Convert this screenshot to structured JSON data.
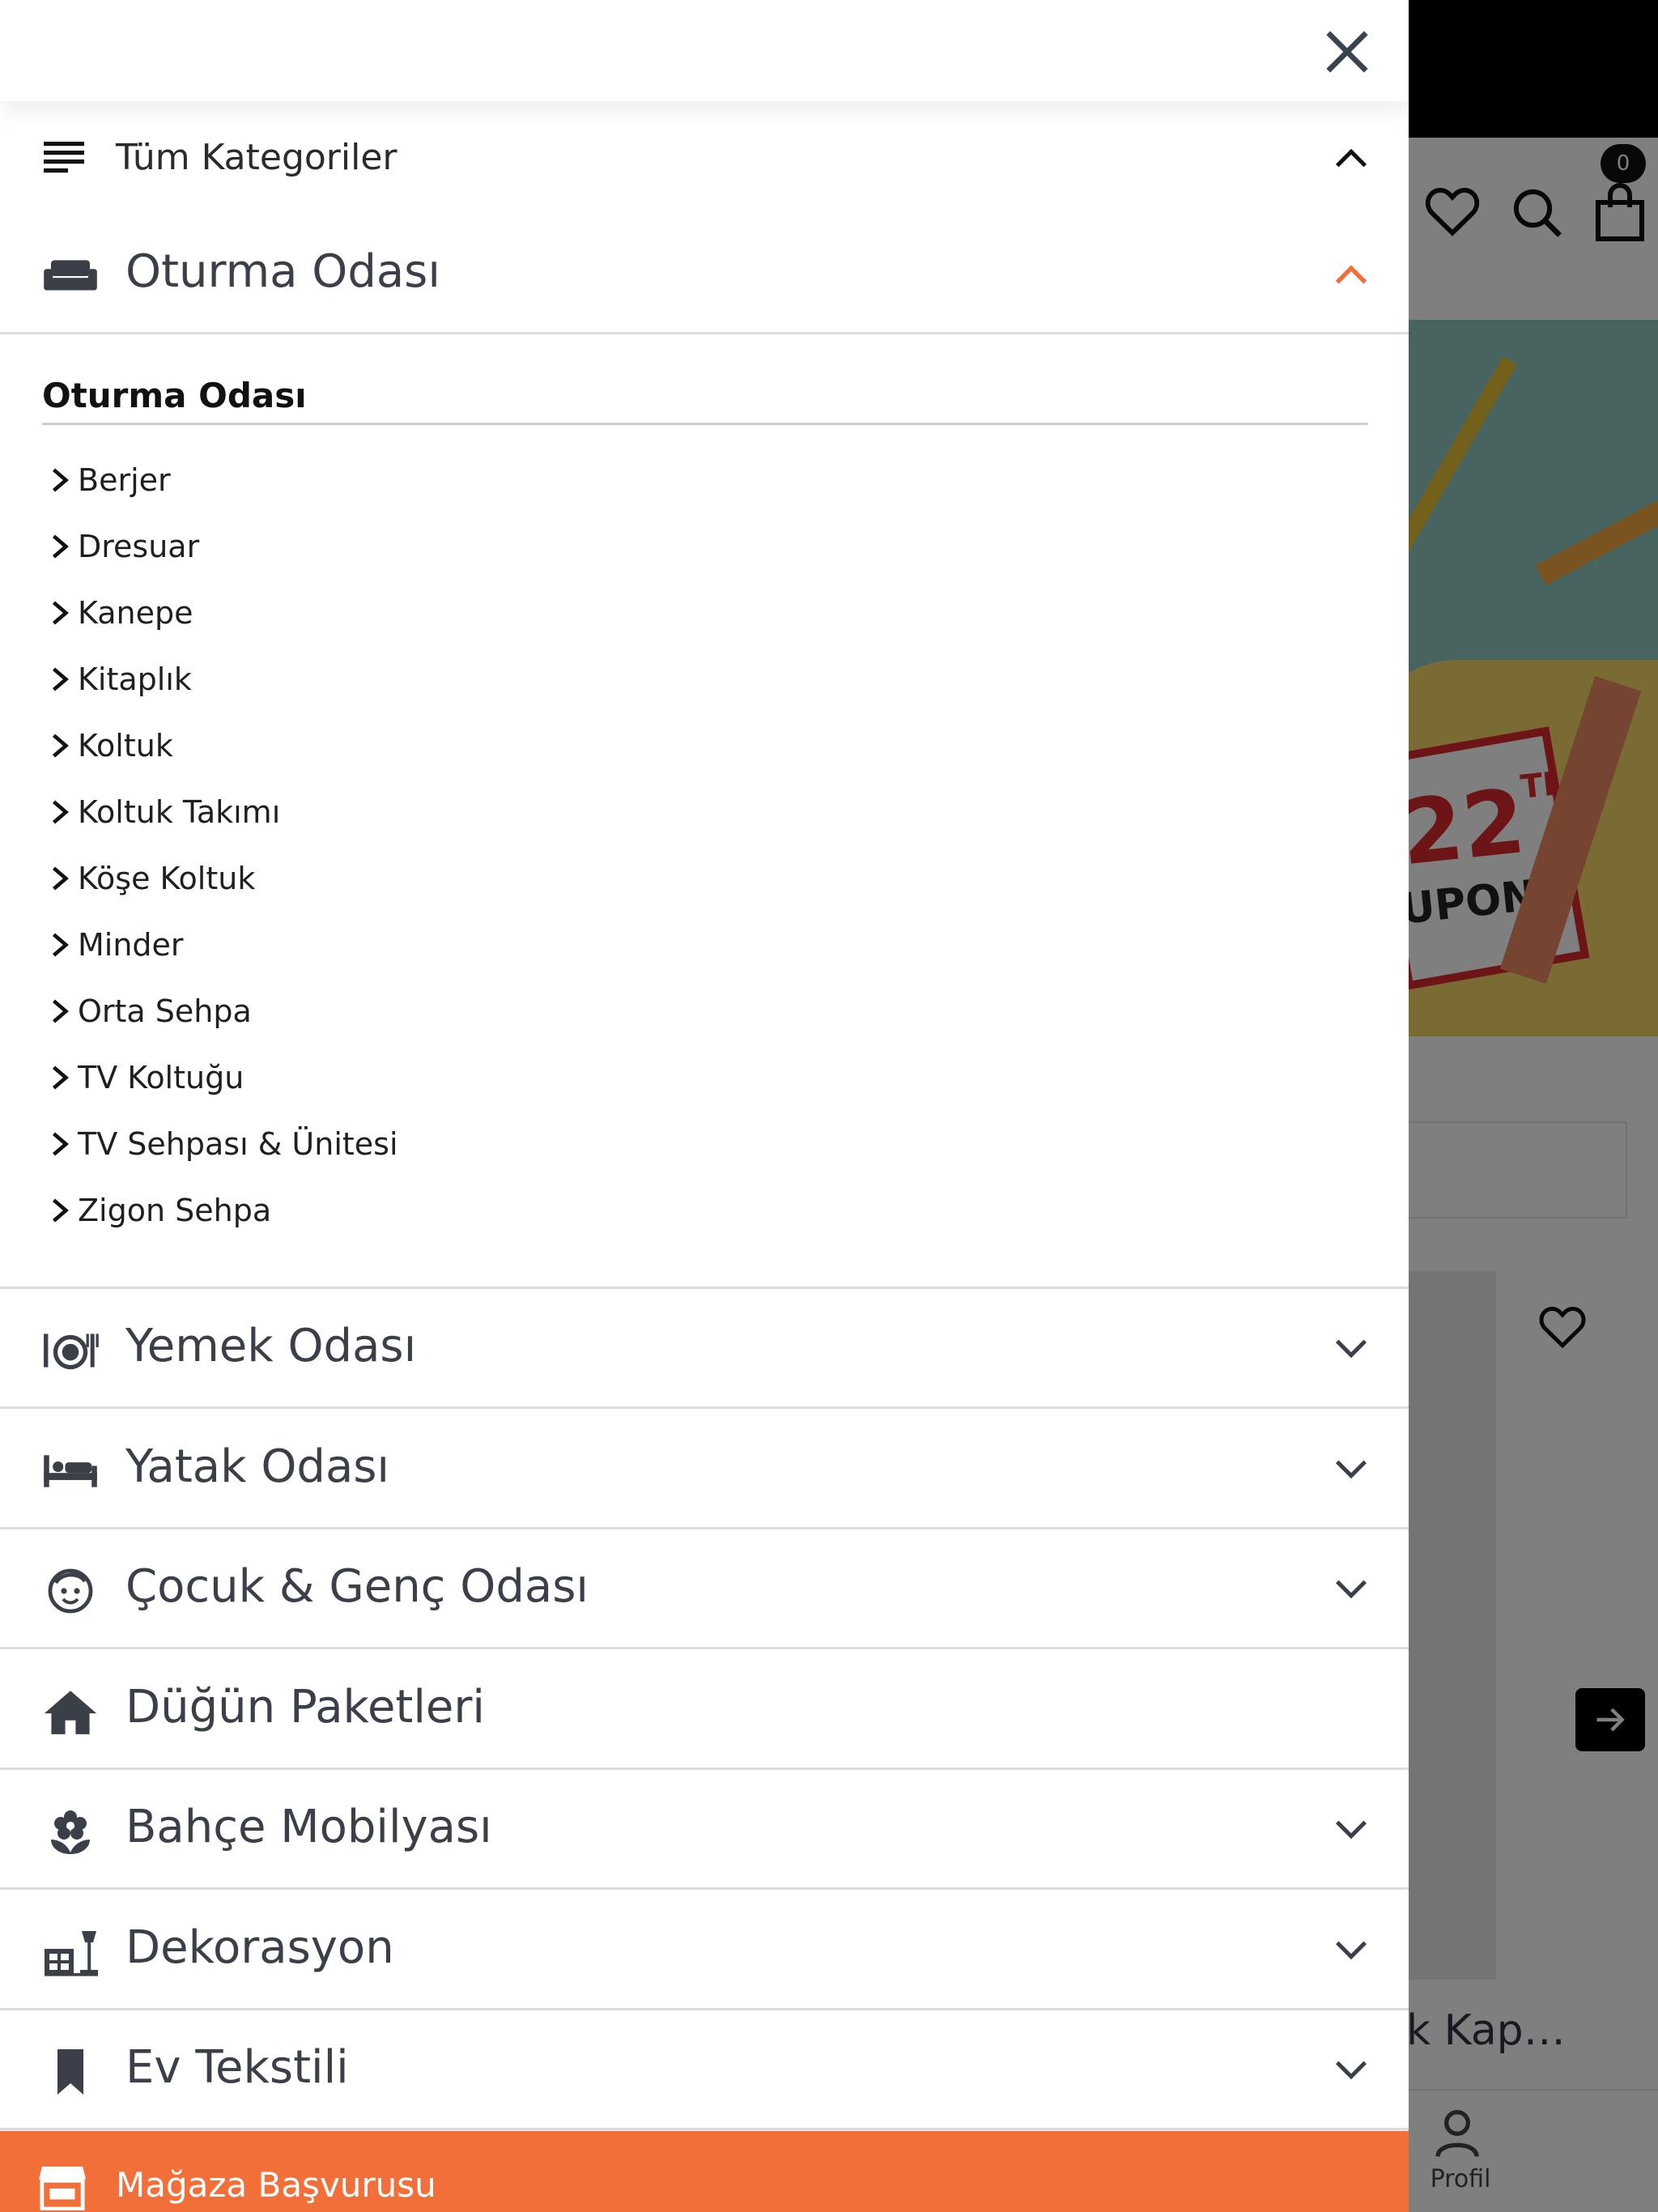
{
  "background": {
    "cart_count": "0",
    "banner": {
      "amount": "22",
      "currency": "TL",
      "coupon_text": "UPON"
    },
    "product_title_partial": "ek Kap…",
    "bottom_nav": {
      "profile_label": "Profil"
    }
  },
  "drawer": {
    "all_categories_label": "Tüm Kategoriler",
    "expanded_category": {
      "label": "Oturma Odası",
      "icon": "sofa-icon",
      "submenu_title": "Oturma Odası",
      "items": [
        "Berjer",
        "Dresuar",
        "Kanepe",
        "Kitaplık",
        "Koltuk",
        "Koltuk Takımı",
        "Köşe Koltuk",
        "Minder",
        "Orta Sehpa",
        "TV Koltuğu",
        "TV Sehpası & Ünitesi",
        "Zigon Sehpa"
      ]
    },
    "categories": [
      {
        "label": "Yemek Odası",
        "icon": "dining-icon",
        "has_children": true
      },
      {
        "label": "Yatak Odası",
        "icon": "bed-icon",
        "has_children": true
      },
      {
        "label": "Çocuk & Genç Odası",
        "icon": "child-face-icon",
        "has_children": true
      },
      {
        "label": "Düğün Paketleri",
        "icon": "home-icon",
        "has_children": false
      },
      {
        "label": "Bahçe Mobilyası",
        "icon": "flower-icon",
        "has_children": true
      },
      {
        "label": "Dekorasyon",
        "icon": "lamp-furniture-icon",
        "has_children": true
      },
      {
        "label": "Ev Tekstili",
        "icon": "bookmark-icon",
        "has_children": true
      }
    ],
    "store_application_label": "Mağaza Başvurusu"
  },
  "colors": {
    "accent": "#f26f3a",
    "text": "#3a3f48",
    "divider": "#dcdcdc"
  }
}
